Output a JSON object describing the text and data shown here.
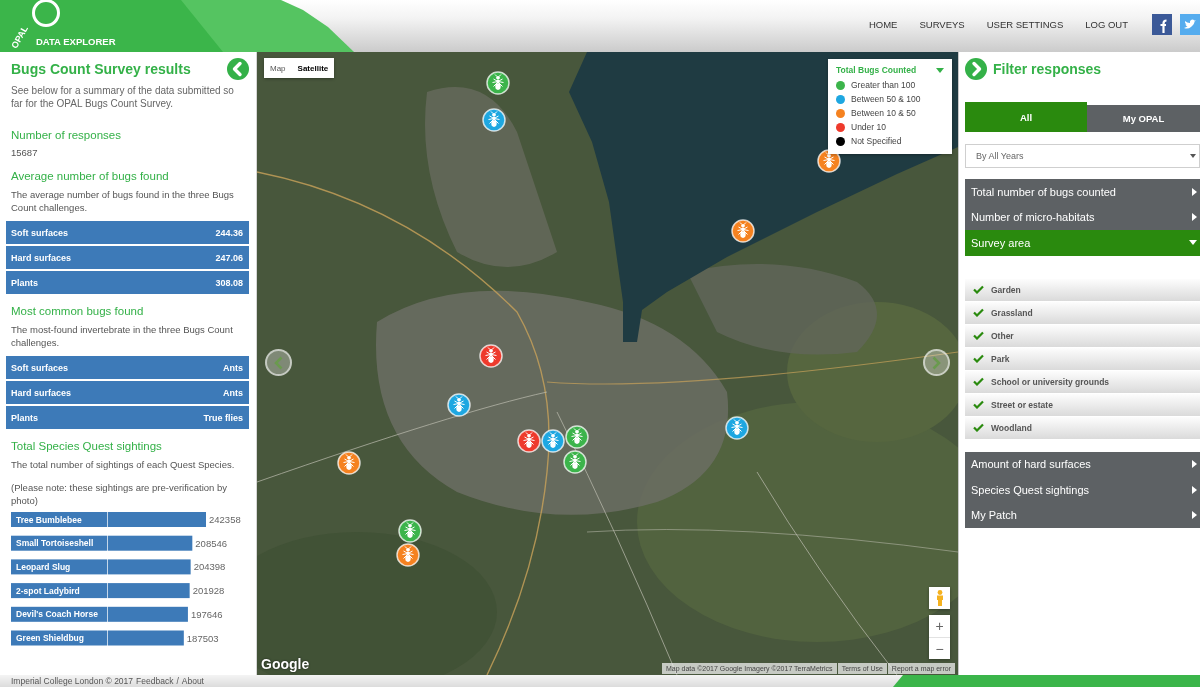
{
  "header": {
    "logo_text": "OPAL",
    "app_name": "DATA EXPLORER",
    "nav": [
      "HOME",
      "SURVEYS",
      "USER SETTINGS",
      "LOG OUT"
    ]
  },
  "results_panel": {
    "title": "Bugs Count Survey results",
    "intro": "See below for a summary of the data submitted so far for the OPAL Bugs Count Survey.",
    "sections": [
      {
        "kind": "number",
        "heading": "Number of responses",
        "value": "15687"
      },
      {
        "kind": "table",
        "heading": "Average number of bugs found",
        "description": "The average number of bugs found in the three Bugs Count challenges.",
        "rows": [
          {
            "label": "Soft surfaces",
            "value": "244.36"
          },
          {
            "label": "Hard surfaces",
            "value": "247.06"
          },
          {
            "label": "Plants",
            "value": "308.08"
          }
        ]
      },
      {
        "kind": "table",
        "heading": "Most common bugs found",
        "description": "The most-found invertebrate in the three Bugs Count challenges.",
        "rows": [
          {
            "label": "Soft surfaces",
            "value": "Ants"
          },
          {
            "label": "Hard surfaces",
            "value": "Ants"
          },
          {
            "label": "Plants",
            "value": "True flies"
          }
        ]
      },
      {
        "kind": "chart",
        "heading": "Total Species Quest sightings",
        "description": "The total number of sightings of each Quest Species.",
        "note": "(Please note: these sightings are pre-verification by photo)",
        "chart_data": {
          "type": "bar",
          "orientation": "horizontal",
          "categories": [
            "Tree Bumblebee",
            "Small Tortoiseshell",
            "Leopard Slug",
            "2-spot Ladybird",
            "Devil's Coach Horse",
            "Green Shieldbug"
          ],
          "values": [
            242358,
            208546,
            204398,
            201928,
            197646,
            187503
          ],
          "data_labels": true
        }
      }
    ]
  },
  "map": {
    "type_toggle": [
      {
        "label": "Map",
        "selected": false
      },
      {
        "label": "Satellite",
        "selected": true
      }
    ],
    "legend": {
      "title": "Total Bugs Counted",
      "items": [
        {
          "label": "Greater than 100",
          "color": "#3cb44b"
        },
        {
          "label": "Between 50 & 100",
          "color": "#1ea7e1"
        },
        {
          "label": "Between 10 & 50",
          "color": "#f58220"
        },
        {
          "label": "Under 10",
          "color": "#ee3a2c"
        },
        {
          "label": "Not Specified",
          "color": "#000000"
        }
      ]
    },
    "markers": [
      {
        "color": "#3cb44b"
      },
      {
        "color": "#1ea7e1"
      },
      {
        "color": "#f58220"
      },
      {
        "color": "#f58220"
      },
      {
        "color": "#ee3a2c"
      },
      {
        "color": "#1ea7e1"
      },
      {
        "color": "#f58220"
      },
      {
        "color": "#ee3a2c"
      },
      {
        "color": "#1ea7e1"
      },
      {
        "color": "#3cb44b"
      },
      {
        "color": "#3cb44b"
      },
      {
        "color": "#1ea7e1"
      },
      {
        "color": "#3cb44b"
      },
      {
        "color": "#f58220"
      }
    ],
    "zoom": [
      "+",
      "−"
    ],
    "logo": "Google",
    "attribution": [
      "Map data ©2017 Google Imagery ©2017 TerraMetrics",
      "Terms of Use",
      "Report a map error"
    ]
  },
  "filter_panel": {
    "title": "Filter responses",
    "tabs": [
      {
        "label": "All",
        "selected": true
      },
      {
        "label": "My OPAL",
        "selected": false
      }
    ],
    "year_select": {
      "value": "By All Years"
    },
    "sections": [
      {
        "label": "Total number of bugs counted",
        "expanded": false
      },
      {
        "label": "Number of micro-habitats",
        "expanded": false
      },
      {
        "label": "Survey area",
        "expanded": true,
        "options": [
          {
            "label": "Garden",
            "checked": true
          },
          {
            "label": "Grassland",
            "checked": true
          },
          {
            "label": "Other",
            "checked": true
          },
          {
            "label": "Park",
            "checked": true
          },
          {
            "label": "School or university grounds",
            "checked": true
          },
          {
            "label": "Street or estate",
            "checked": true
          },
          {
            "label": "Woodland",
            "checked": true
          }
        ]
      },
      {
        "label": "Amount of hard surfaces",
        "expanded": false
      },
      {
        "label": "Species Quest sightings",
        "expanded": false
      },
      {
        "label": "My Patch",
        "expanded": false
      }
    ]
  },
  "footer": {
    "copyright": "Imperial College London © 2017",
    "links": [
      "Feedback",
      "About"
    ],
    "separator": "/"
  }
}
